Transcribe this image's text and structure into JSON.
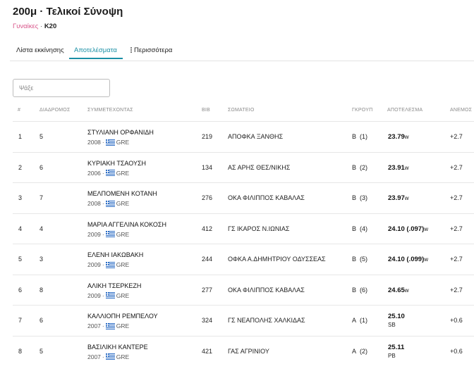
{
  "event": {
    "title": "200μ · Τελικοί Σύνοψη",
    "category": "Γυναίκες",
    "separator": "·",
    "age_group": "Κ20"
  },
  "tabs": [
    {
      "label": "Λίστα εκκίνησης"
    },
    {
      "label": "Αποτελέσματα"
    },
    {
      "label": "Περισσότερα"
    }
  ],
  "search": {
    "placeholder": "Ψάξε"
  },
  "columns": {
    "rank": "#",
    "lane": "ΔΙΑΔΡΟΜΟΣ",
    "athlete": "ΣΥΜΜΕΤΕΧΟΝΤΑΣ",
    "bib": "BIB",
    "club": "ΣΩΜΑΤΕΙΟ",
    "group": "ΓΚΡΟΥΠ",
    "result": "ΑΠΟΤΕΛΕΣΜΑ",
    "wind": "ΑΝΕΜΟΣ"
  },
  "colors": {
    "accent": "#1a8fa5",
    "category": "#d9578b"
  },
  "rows": [
    {
      "rank": "1",
      "lane": "5",
      "name": "ΣΤΥΛΙΑΝΗ ΟΡΦΑΝΙΔΗ",
      "year": "2008",
      "country": "GRE",
      "bib": "219",
      "club": "ΑΠΟΦΚΑ ΞΑΝΘΗΣ",
      "group": "B",
      "group_pos": "(1)",
      "mark": "23.79",
      "mark_suffix": "w",
      "record": "",
      "wind": "+2.7"
    },
    {
      "rank": "2",
      "lane": "6",
      "name": "ΚΥΡΙΑΚΗ ΤΣΑΟΥΣΗ",
      "year": "2006",
      "country": "GRE",
      "bib": "134",
      "club": "ΑΣ ΑΡΗΣ ΘΕΣ/ΝΙΚΗΣ",
      "group": "B",
      "group_pos": "(2)",
      "mark": "23.91",
      "mark_suffix": "w",
      "record": "",
      "wind": "+2.7"
    },
    {
      "rank": "3",
      "lane": "7",
      "name": "ΜΕΛΠΟΜΕΝΗ ΚΟΤΑΝΗ",
      "year": "2008",
      "country": "GRE",
      "bib": "276",
      "club": "ΟΚΑ ΦΙΛΙΠΠΟΣ ΚΑΒΑΛΑΣ",
      "group": "B",
      "group_pos": "(3)",
      "mark": "23.97",
      "mark_suffix": "w",
      "record": "",
      "wind": "+2.7"
    },
    {
      "rank": "4",
      "lane": "4",
      "name": "ΜΑΡΙΑ ΑΓΓΕΛΙΝΑ ΚΟΚΟΣΗ",
      "year": "2009",
      "country": "GRE",
      "bib": "412",
      "club": "ΓΣ ΙΚΑΡΟΣ Ν.ΙΩΝΙΑΣ",
      "group": "B",
      "group_pos": "(4)",
      "mark": "24.10 (.097)",
      "mark_suffix": "w",
      "record": "",
      "wind": "+2.7"
    },
    {
      "rank": "5",
      "lane": "3",
      "name": "ΕΛΕΝΗ ΙΑΚΩΒΑΚΗ",
      "year": "2009",
      "country": "GRE",
      "bib": "244",
      "club": "ΟΦΚΑ Α.ΔΗΜΗΤΡΙΟΥ ΟΔΥΣΣΕΑΣ",
      "group": "B",
      "group_pos": "(5)",
      "mark": "24.10 (.099)",
      "mark_suffix": "w",
      "record": "",
      "wind": "+2.7"
    },
    {
      "rank": "6",
      "lane": "8",
      "name": "ΑΛΙΚΗ ΤΣΕΡΚΕΖΗ",
      "year": "2009",
      "country": "GRE",
      "bib": "277",
      "club": "ΟΚΑ ΦΙΛΙΠΠΟΣ ΚΑΒΑΛΑΣ",
      "group": "B",
      "group_pos": "(6)",
      "mark": "24.65",
      "mark_suffix": "w",
      "record": "",
      "wind": "+2.7"
    },
    {
      "rank": "7",
      "lane": "6",
      "name": "ΚΑΛΛΙΟΠΗ ΡΕΜΠΕΛΟΥ",
      "year": "2007",
      "country": "GRE",
      "bib": "324",
      "club": "ΓΣ ΝΕΑΠΟΛΗΣ ΧΑΛΚΙΔΑΣ",
      "group": "A",
      "group_pos": "(1)",
      "mark": "25.10",
      "mark_suffix": "",
      "record": "SB",
      "wind": "+0.6"
    },
    {
      "rank": "8",
      "lane": "5",
      "name": "ΒΑΣΙΛΙΚΗ ΚΑΝΤΕΡΕ",
      "year": "2007",
      "country": "GRE",
      "bib": "421",
      "club": "ΓΑΣ ΑΓΡΙΝΙΟΥ",
      "group": "A",
      "group_pos": "(2)",
      "mark": "25.11",
      "mark_suffix": "",
      "record": "PB",
      "wind": "+0.6"
    }
  ]
}
